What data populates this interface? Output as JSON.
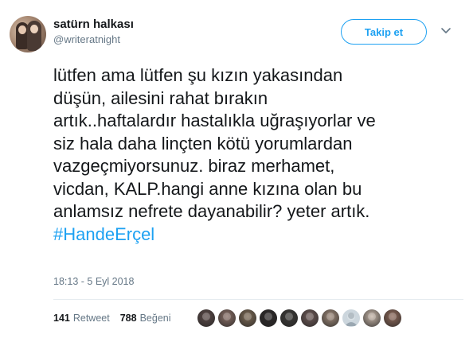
{
  "user": {
    "display_name": "satürn halkası",
    "handle": "@writeratnight"
  },
  "follow_button": {
    "label": "Takip et"
  },
  "tweet": {
    "lines": [
      "lütfen ama lütfen şu kızın yakasından",
      "düşün, ailesini rahat bırakın",
      "artık..haftalardır hastalıkla uğraşıyorlar ve",
      "siz hala daha linçten kötü yorumlardan",
      "vazgeçmiyorsunuz. biraz merhamet,",
      "vicdan, KALP.hangi anne kızına olan bu",
      "anlamsız nefrete dayanabilir? yeter artık."
    ],
    "hashtag": "#HandeErçel",
    "timestamp": "18:13 - 5 Eyl 2018"
  },
  "stats": {
    "retweet_count": "141",
    "retweet_label": "Retweet",
    "like_count": "788",
    "like_label": "Beğeni"
  },
  "likers": [
    {
      "icon": "avatar",
      "color": "#5b4a48"
    },
    {
      "icon": "avatar",
      "color": "#8a6f66"
    },
    {
      "icon": "avatar",
      "color": "#7d6a55"
    },
    {
      "icon": "avatar",
      "color": "#2e2a2a"
    },
    {
      "icon": "avatar",
      "color": "#3d3b38"
    },
    {
      "icon": "avatar",
      "color": "#6e5a57"
    },
    {
      "icon": "avatar",
      "color": "#a08a7a"
    },
    {
      "icon": "default-avatar",
      "color": "#9aa7b1"
    },
    {
      "icon": "avatar",
      "color": "#c7b6a8"
    },
    {
      "icon": "avatar",
      "color": "#8f6a5a"
    }
  ],
  "colors": {
    "accent": "#1da1f2",
    "muted": "#657786",
    "text": "#14171a",
    "divider": "#e6ecf0"
  }
}
